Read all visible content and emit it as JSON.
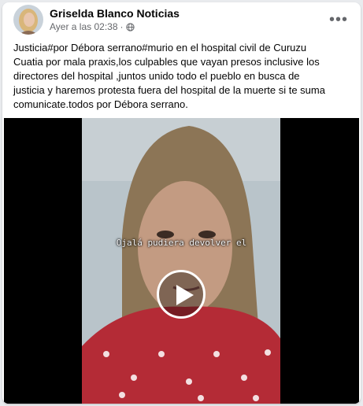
{
  "post": {
    "author": "Griselda Blanco Noticias",
    "timestamp": "Ayer a las 02:38",
    "separator": "·",
    "audience_icon": "globe-icon",
    "more_label": "•••",
    "text": "Justicia#por Débora serrano#murio en el hospital civil de Curuzu\nCuatia por mala praxis,los culpables  que vayan presos inclusive los\ndirectores del hospital ,juntos unido todo el pueblo en busca de\njusticia y haremos protesta  fuera del hospital de la muerte si te suma\ncomunicate.todos por Débora  serrano."
  },
  "video": {
    "caption": "Ojalá pudiera devolver el",
    "play_icon": "play-icon"
  },
  "colors": {
    "author": "#050505",
    "meta": "#65676b",
    "background": "#e9ebee"
  }
}
